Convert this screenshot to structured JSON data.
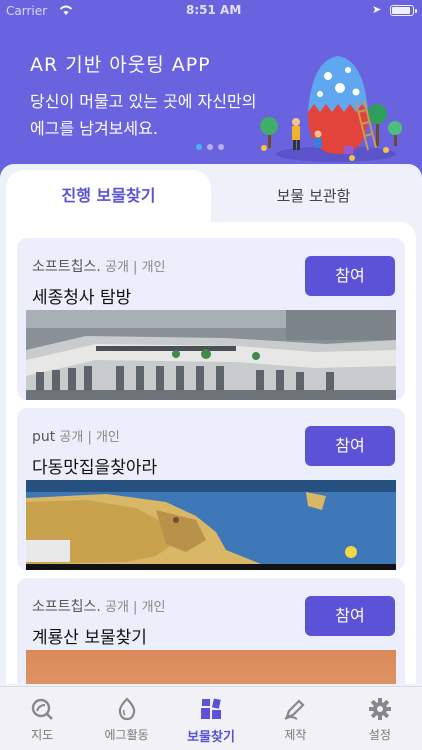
{
  "status_bar": {
    "carrier": "Carrier",
    "time": "8:51 AM"
  },
  "banner": {
    "title": "AR 기반 아웃팅 APP",
    "subtitle": "당신이 머물고 있는 곳에 자신만의 에그를 남겨보세요.",
    "dots": 3,
    "active_dot": 0
  },
  "tabs": [
    {
      "label": "진행 보물찾기",
      "active": true
    },
    {
      "label": "보물 보관함",
      "active": false
    }
  ],
  "cards": [
    {
      "owner": "소프트칩스.",
      "visibility": "공개 | 개인",
      "title": "세종청사 탐방",
      "button": "참여",
      "image": "building-rooftop-photo"
    },
    {
      "owner": "put",
      "visibility": "공개 | 개인",
      "title": "다동맛집을찾아라",
      "button": "참여",
      "image": "korea-map"
    },
    {
      "owner": "소프트칩스.",
      "visibility": "공개 | 개인",
      "title": "계룡산 보물찾기",
      "button": "참여",
      "image": "sunset-photo"
    }
  ],
  "bottom_nav": [
    {
      "label": "지도",
      "icon": "map-search-icon",
      "active": false
    },
    {
      "label": "에그활동",
      "icon": "egg-icon",
      "active": false
    },
    {
      "label": "보물찾기",
      "icon": "treasure-blocks-icon",
      "active": true
    },
    {
      "label": "제작",
      "icon": "pencil-create-icon",
      "active": false
    },
    {
      "label": "설정",
      "icon": "gear-icon",
      "active": false
    }
  ],
  "colors": {
    "primary": "#5b52d8",
    "banner": "#6a63e0",
    "card": "#eceefb"
  }
}
